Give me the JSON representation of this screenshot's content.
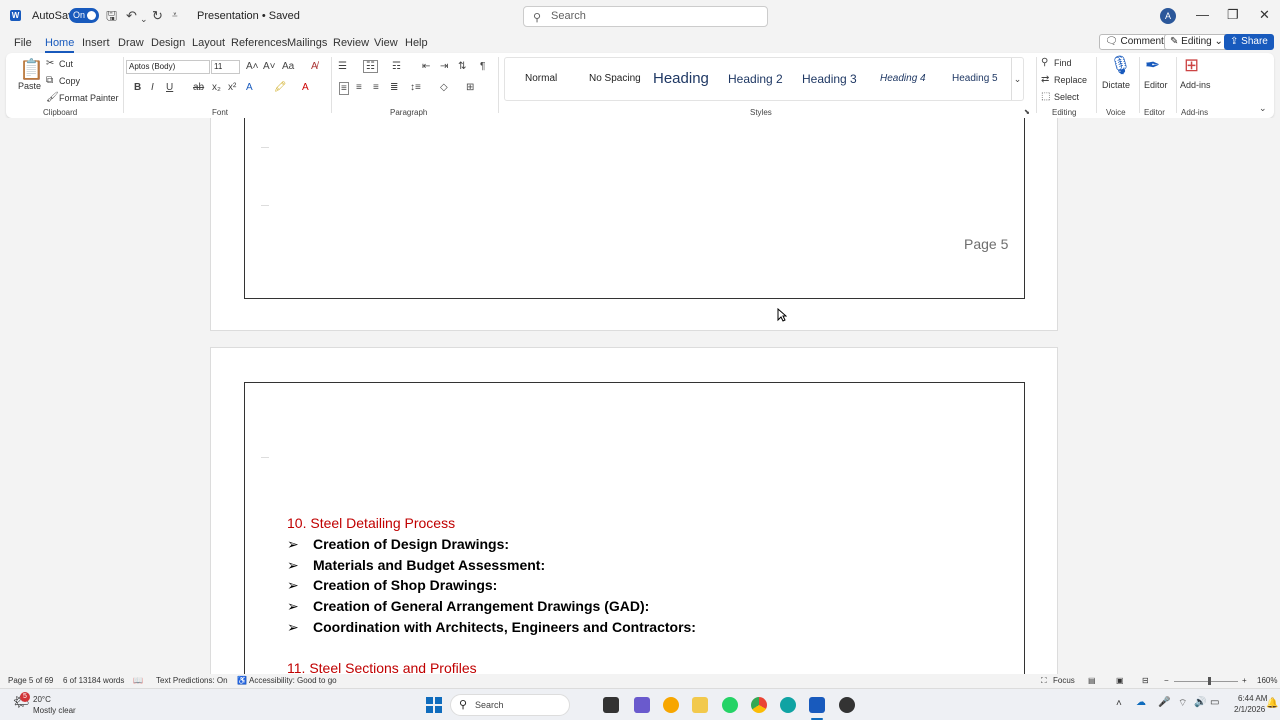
{
  "titlebar": {
    "app_logo": "W",
    "autosave_label": "AutoSave",
    "autosave_state": "On",
    "doc_title": "Presentation • Saved",
    "search_placeholder": "Search",
    "user_initial": "A",
    "icons": [
      "save-icon",
      "undo-icon",
      "redo-icon",
      "customize-icon"
    ]
  },
  "menu": {
    "tabs": [
      "File",
      "Home",
      "Insert",
      "Draw",
      "Design",
      "Layout",
      "References",
      "Mailings",
      "Review",
      "View",
      "Help"
    ],
    "active_tab": "Home",
    "comments": "Comments",
    "editing": "Editing",
    "share": "Share"
  },
  "ribbon": {
    "clipboard": {
      "paste": "Paste",
      "cut": "Cut",
      "copy": "Copy",
      "format_painter": "Format Painter",
      "label": "Clipboard"
    },
    "font": {
      "font_name": "Aptos (Body)",
      "font_size": "11",
      "label": "Font"
    },
    "paragraph": {
      "label": "Paragraph"
    },
    "styles": {
      "items": [
        "Normal",
        "No Spacing",
        "Heading",
        "Heading 2",
        "Heading 3",
        "Heading 4",
        "Heading 5"
      ],
      "label": "Styles"
    },
    "editing": {
      "find": "Find",
      "replace": "Replace",
      "select": "Select",
      "label": "Editing"
    },
    "voice": {
      "dictate": "Dictate",
      "label": "Voice"
    },
    "editor": {
      "editor": "Editor",
      "label": "Editor"
    },
    "addins": {
      "addins": "Add-ins",
      "label": "Add-ins"
    }
  },
  "document": {
    "page5_footer": "Page 5",
    "section10": "10. Steel Detailing Process",
    "bullets": [
      "Creation of Design Drawings:",
      "Materials and Budget Assessment:",
      "Creation of Shop Drawings:",
      "Creation of General Arrangement Drawings (GAD):",
      "Coordination with Architects, Engineers and Contractors:"
    ],
    "bullet_glyph": "➢",
    "section11": "11. Steel Sections and Profiles"
  },
  "status": {
    "page": "Page 5 of 69",
    "words": "6 of 13184 words",
    "predictions": "Text Predictions: On",
    "accessibility": "Accessibility: Good to go",
    "focus": "Focus",
    "zoom": "160%"
  },
  "taskbar": {
    "temp": "20°C",
    "weather": "Mostly clear",
    "weather_badge": "5",
    "search": "Search",
    "time": "6:44 AM",
    "date": "2/1/2026"
  },
  "colors": {
    "accent": "#185abd",
    "heading_red": "#c00000"
  }
}
